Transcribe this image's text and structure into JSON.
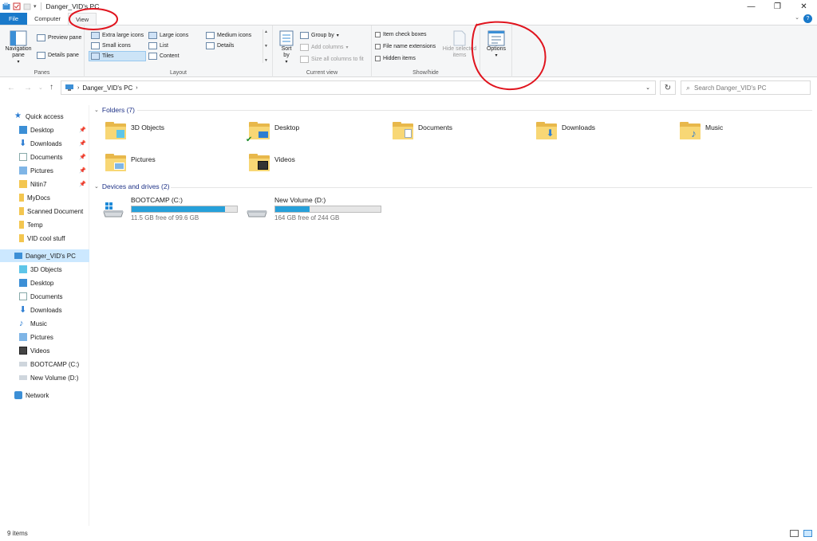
{
  "window": {
    "title": "Danger_VID's PC",
    "controls": {
      "minimize": "—",
      "maximize": "❐",
      "close": "✕"
    }
  },
  "ribbon": {
    "tabs": [
      {
        "label": "File"
      },
      {
        "label": "Computer"
      },
      {
        "label": "View"
      }
    ],
    "panes": {
      "label": "Panes",
      "navigation_pane": "Navigation pane",
      "preview_pane": "Preview pane",
      "details_pane": "Details pane"
    },
    "layout": {
      "label": "Layout",
      "items": [
        "Extra large icons",
        "Large icons",
        "Medium icons",
        "Small icons",
        "List",
        "Details",
        "Tiles",
        "Content"
      ],
      "selected": "Tiles"
    },
    "current_view": {
      "label": "Current view",
      "sort_by": "Sort by",
      "group_by": "Group by",
      "add_columns": "Add columns",
      "size_all_columns": "Size all columns to fit"
    },
    "show_hide": {
      "label": "Show/hide",
      "item_check_boxes": "Item check boxes",
      "file_name_extensions": "File name extensions",
      "hidden_items": "Hidden items",
      "hide_selected_items": "Hide selected items"
    },
    "options": {
      "label": "Options"
    }
  },
  "address": {
    "path": "Danger_VID's PC",
    "search_placeholder": "Search Danger_VID's PC"
  },
  "sidebar": {
    "quick_access": "Quick access",
    "quick_items": [
      {
        "label": "Desktop",
        "pinned": true
      },
      {
        "label": "Downloads",
        "pinned": true
      },
      {
        "label": "Documents",
        "pinned": true
      },
      {
        "label": "Pictures",
        "pinned": true
      },
      {
        "label": "Nitin7",
        "pinned": true
      },
      {
        "label": "MyDocs",
        "pinned": false
      },
      {
        "label": "Scanned Document",
        "pinned": false
      },
      {
        "label": "Temp",
        "pinned": false
      },
      {
        "label": "VID cool stuff",
        "pinned": false
      }
    ],
    "this_pc": "Danger_VID's PC",
    "pc_items": [
      "3D Objects",
      "Desktop",
      "Documents",
      "Downloads",
      "Music",
      "Pictures",
      "Videos",
      "BOOTCAMP (C:)",
      "New Volume (D:)"
    ],
    "network": "Network"
  },
  "content": {
    "folders_header": "Folders (7)",
    "folders": [
      "3D Objects",
      "Desktop",
      "Documents",
      "Downloads",
      "Music",
      "Pictures",
      "Videos"
    ],
    "drives_header": "Devices and drives (2)",
    "drives": [
      {
        "name": "BOOTCAMP (C:)",
        "free_text": "11.5 GB free of 99.6 GB",
        "used_fraction": 0.885
      },
      {
        "name": "New Volume (D:)",
        "free_text": "164 GB free of 244 GB",
        "used_fraction": 0.328
      }
    ]
  },
  "status": {
    "item_count": "9 items"
  },
  "colors": {
    "accent": "#1979ca",
    "drive_bar": "#26a0da",
    "selection": "#cce8ff",
    "annotation": "#e0141e"
  }
}
